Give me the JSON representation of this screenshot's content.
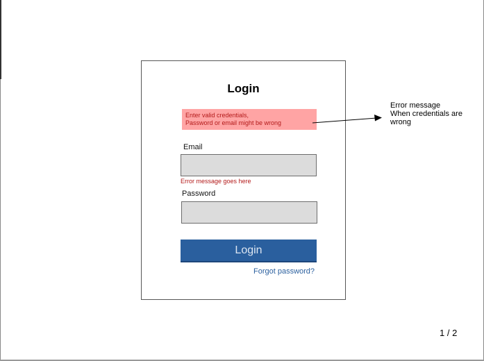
{
  "login": {
    "title": "Login",
    "error_banner": {
      "line1": "Enter valid credentials,",
      "line2": "Password or email might be wrong"
    },
    "email": {
      "label": "Email",
      "value": "",
      "error": "Error message goes here"
    },
    "password": {
      "label": "Password",
      "value": ""
    },
    "submit_label": "Login",
    "forgot_label": "Forgot password?"
  },
  "annotation": {
    "line1": "Error message",
    "line2": "When credentials are",
    "line3": "wrong"
  },
  "page_counter": "1 / 2",
  "colors": {
    "error_banner_bg": "#ffa4a4",
    "error_text": "#b31a1a",
    "button_bg": "#2a5f9e",
    "field_bg": "#dcdcdc",
    "link": "#2a5f9e"
  }
}
